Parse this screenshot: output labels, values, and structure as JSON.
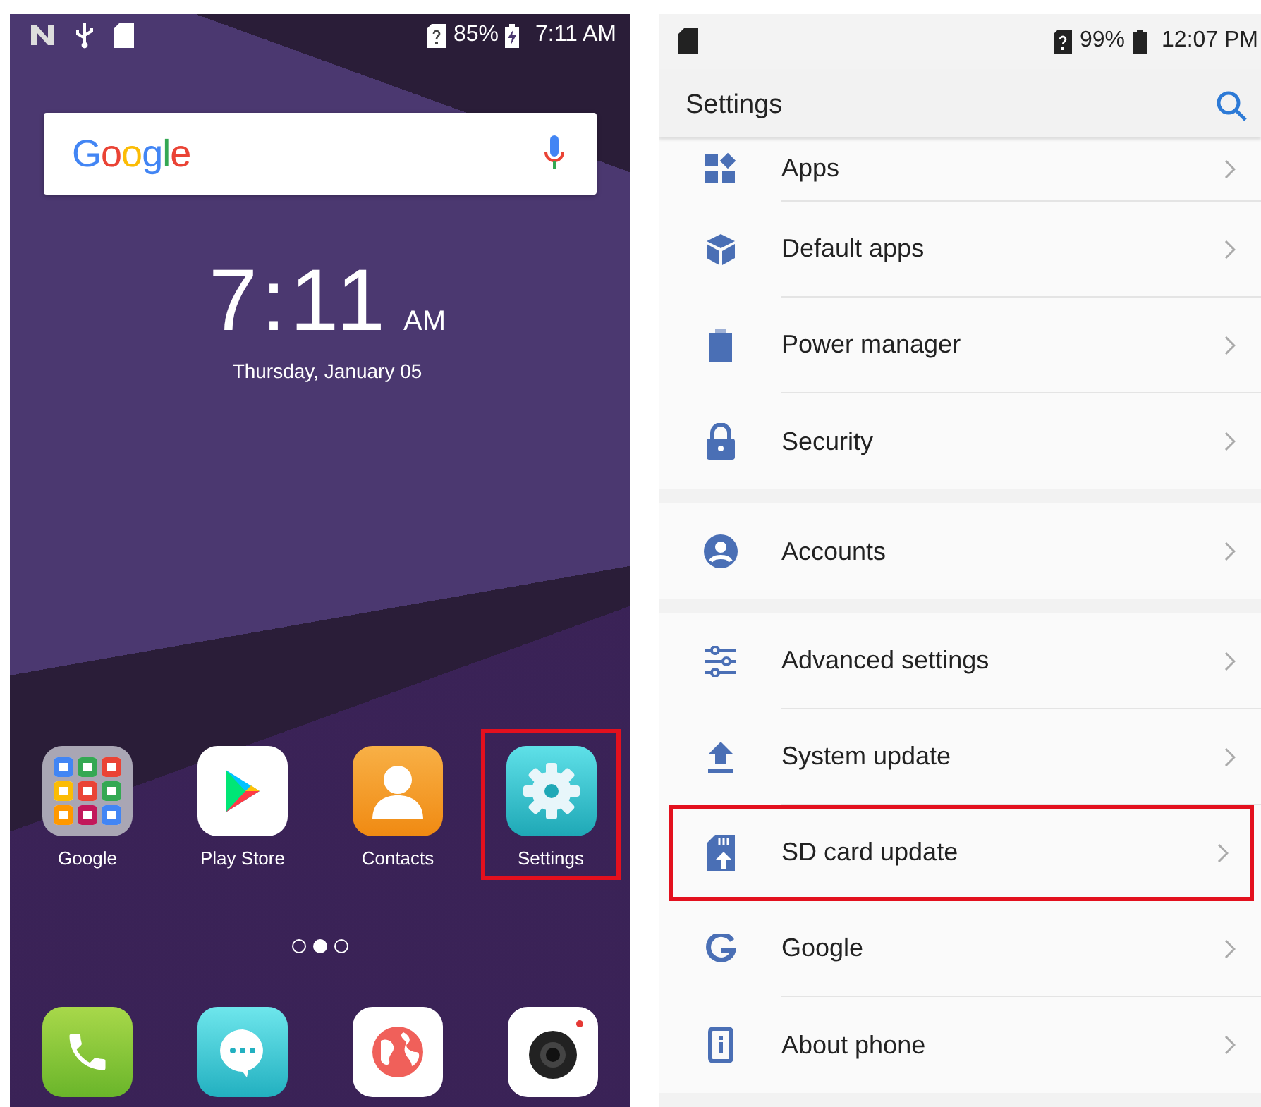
{
  "home": {
    "status_bar": {
      "battery": "85%",
      "time": "7:11 AM"
    },
    "search_bar": {
      "logo": "Google"
    },
    "clock": {
      "time": "7:11",
      "period": "AM",
      "date": "Thursday, January 05"
    },
    "apps": [
      {
        "label": "Google",
        "highlighted": false
      },
      {
        "label": "Play Store",
        "highlighted": false
      },
      {
        "label": "Contacts",
        "highlighted": false
      },
      {
        "label": "Settings",
        "highlighted": true
      }
    ],
    "page_indicator": [
      {
        "selected": false
      },
      {
        "selected": true
      },
      {
        "selected": false
      }
    ]
  },
  "settings": {
    "status_bar": {
      "battery": "99%",
      "time": "12:07 PM"
    },
    "title": "Settings",
    "sections": [
      {
        "rows": [
          {
            "label": "Apps",
            "highlighted": false
          },
          {
            "label": "Default apps",
            "highlighted": false
          },
          {
            "label": "Power manager",
            "highlighted": false
          },
          {
            "label": "Security",
            "highlighted": false
          }
        ]
      },
      {
        "rows": [
          {
            "label": "Accounts",
            "highlighted": false
          }
        ]
      },
      {
        "rows": [
          {
            "label": "Advanced settings",
            "highlighted": false
          },
          {
            "label": "System update",
            "highlighted": false
          },
          {
            "label": "SD card update",
            "highlighted": true
          },
          {
            "label": "Google",
            "highlighted": false
          },
          {
            "label": "About phone",
            "highlighted": false
          }
        ]
      }
    ]
  }
}
